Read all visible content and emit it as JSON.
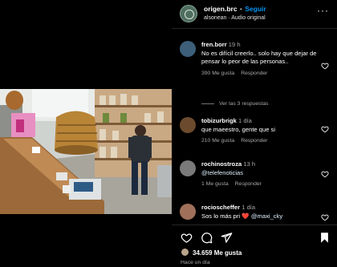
{
  "post": {
    "username": "origen.brc",
    "follow_label": "Seguir",
    "audio": "alsonean · Audio original",
    "more_icon": "more-horizontal-icon"
  },
  "comments": [
    {
      "username": "fren.borr",
      "time": "19 h",
      "text": "No es difícil creerlo.. solo hay que dejar de pensar lo peor de las personas..",
      "likes": "390 Me gusta",
      "reply": "Responder",
      "avatar_color": "#3d5f7a"
    },
    {
      "username": "tobizurbrigk",
      "time": "1 día",
      "text": "que maeestro, gente que si",
      "likes": "210 Me gusta",
      "reply": "Responder",
      "avatar_color": "#6b4a2e"
    },
    {
      "username": "rochinostroza",
      "time": "13 h",
      "text": "@telefenoticias",
      "likes": "1 Me gusta",
      "reply": "Responder",
      "avatar_color": "#7a7a7a"
    },
    {
      "username": "rocioscheffer",
      "time": "1 día",
      "text_before": "Sos lo más pri",
      "heart_emoji": "❤️",
      "mention": "@maxi_cky",
      "avatar_color": "#a0705a"
    }
  ],
  "view_replies": "Ver las 3 respuestas",
  "actions": {
    "like_icon": "heart-icon",
    "comment_icon": "comment-icon",
    "share_icon": "share-icon",
    "save_icon": "bookmark-icon"
  },
  "likes_count": "34.659 Me gusta",
  "posted_ago": "Hace un día",
  "colors": {
    "background": "#000000",
    "link_blue": "#0095f6",
    "muted": "#a8a8a8",
    "divider": "#262626"
  }
}
